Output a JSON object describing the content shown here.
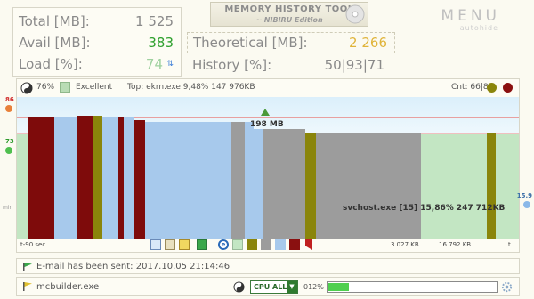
{
  "stats": {
    "total_label": "Total [MB]:",
    "total_value": "1 525",
    "avail_label": "Avail [MB]:",
    "avail_value": "383",
    "load_label": "Load [%]:",
    "load_value": "74"
  },
  "title": {
    "line1": "MEMORY HISTORY TOOL",
    "line2": "~ NIBIRU Edition"
  },
  "theoretical": {
    "label": "Theoretical [MB]:",
    "value": "2 266"
  },
  "history": {
    "label": "History [%]:",
    "value": "50|93|71"
  },
  "menu": {
    "label": "MENU",
    "sub": "autohide"
  },
  "graph": {
    "pct": "76%",
    "quality": "Excellent",
    "top_text": "Top:  ekrn.exe  9,48%  147 976KB",
    "count_text": "Cnt: 66|82",
    "peak_label": "198 MB",
    "bar_label": "svchost.exe [15]  15,86%  247 712KB",
    "left_top": "86",
    "left_mid": "73",
    "left_min": "min",
    "right_val": "15.9",
    "t_start": "t-90 sec",
    "kb1": "3 027 KB",
    "kb2": "16 792 KB",
    "t_end": "t"
  },
  "status": {
    "message": "E-mail has been sent: 2017.10.05 21:14:46"
  },
  "bottom": {
    "process": "mcbuilder.exe",
    "cpu_option": "CPU ALL",
    "cpu_pct": "012%",
    "cpu_fraction": 0.12
  },
  "colors": {
    "dark_red": "#7e0b0b",
    "olive": "#8a850b",
    "light_blue": "#a7c9ec",
    "gray": "#9c9c9c",
    "green": "#c3e6c3"
  }
}
